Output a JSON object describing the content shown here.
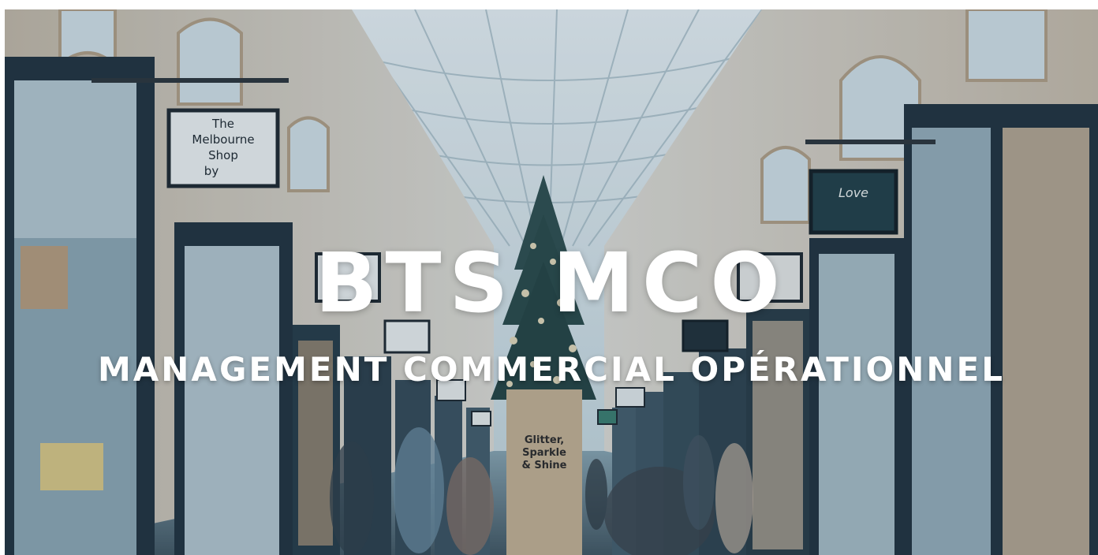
{
  "hero": {
    "title": "BTS MCO",
    "subtitle": "MANAGEMENT COMMERCIAL OPÉRATIONNEL",
    "sign_left_line1": "The",
    "sign_left_line2": "Melbourne",
    "sign_left_line3": "Shop",
    "sign_left_line4": "by",
    "sign_right": "Love",
    "pillar_line1": "Glitter,",
    "pillar_line2": "Sparkle",
    "pillar_line3": "& Shine"
  },
  "colors": {
    "overlay_tint": "#28506e",
    "title_text": "#ffffff",
    "shopfront_dark": "#1c2a33",
    "arcade_roof": "#dfe8ea"
  }
}
